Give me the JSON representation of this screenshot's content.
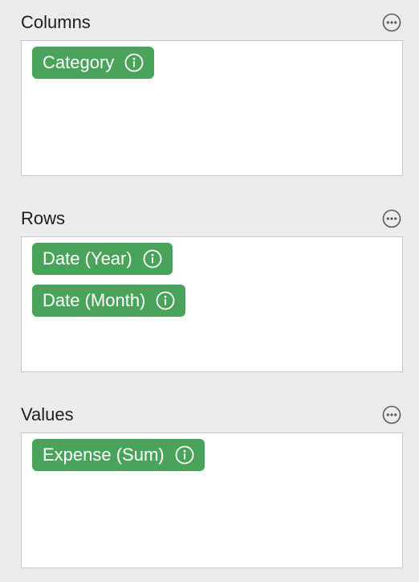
{
  "colors": {
    "pill_background": "#4aa35a",
    "panel_background": "#ececee",
    "zone_background": "#ffffff"
  },
  "sections": {
    "columns": {
      "title": "Columns",
      "more_icon": "ellipsis-circle-icon",
      "fields": [
        {
          "label": "Category",
          "icon": "info-circle-icon"
        }
      ]
    },
    "rows": {
      "title": "Rows",
      "more_icon": "ellipsis-circle-icon",
      "fields": [
        {
          "label": "Date (Year)",
          "icon": "info-circle-icon"
        },
        {
          "label": "Date (Month)",
          "icon": "info-circle-icon"
        }
      ]
    },
    "values": {
      "title": "Values",
      "more_icon": "ellipsis-circle-icon",
      "fields": [
        {
          "label": "Expense (Sum)",
          "icon": "info-circle-icon"
        }
      ]
    }
  }
}
